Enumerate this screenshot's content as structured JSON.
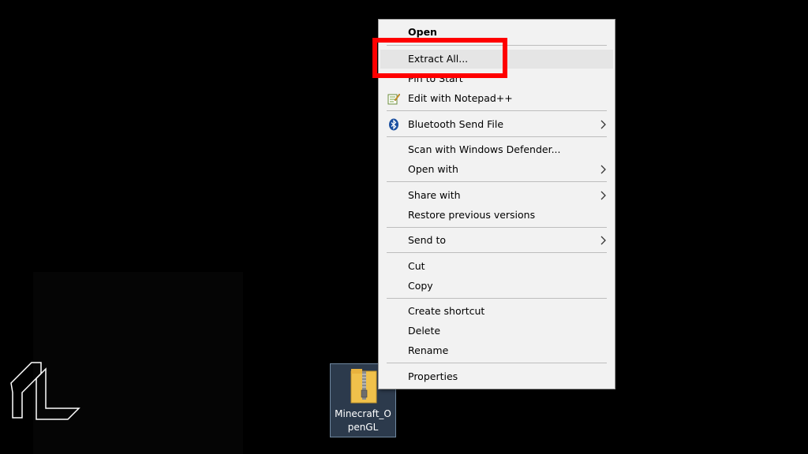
{
  "desktop": {
    "file_name": "Minecraft_OpenGL",
    "file_icon": "zip-folder-icon",
    "logo_icon": "1l-logo-icon"
  },
  "context_menu": {
    "items": [
      {
        "label": "Open",
        "icon": null,
        "submenu": false,
        "bold": true
      },
      {
        "label": "Extract All...",
        "icon": null,
        "submenu": false,
        "highlighted": true
      },
      {
        "label": "Pin to Start",
        "icon": null,
        "submenu": false
      },
      {
        "label": "Edit with Notepad++",
        "icon": "notepad-plus-plus-icon",
        "submenu": false
      },
      {
        "label": "Bluetooth Send File",
        "icon": "bluetooth-icon",
        "submenu": true
      },
      {
        "label": "Scan with Windows Defender...",
        "icon": null,
        "submenu": false
      },
      {
        "label": "Open with",
        "icon": null,
        "submenu": true
      },
      {
        "label": "Share with",
        "icon": null,
        "submenu": true
      },
      {
        "label": "Restore previous versions",
        "icon": null,
        "submenu": false
      },
      {
        "label": "Send to",
        "icon": null,
        "submenu": true
      },
      {
        "label": "Cut",
        "icon": null,
        "submenu": false
      },
      {
        "label": "Copy",
        "icon": null,
        "submenu": false
      },
      {
        "label": "Create shortcut",
        "icon": null,
        "submenu": false
      },
      {
        "label": "Delete",
        "icon": null,
        "submenu": false
      },
      {
        "label": "Rename",
        "icon": null,
        "submenu": false
      },
      {
        "label": "Properties",
        "icon": null,
        "submenu": false
      }
    ]
  },
  "annotation": {
    "highlight_color": "#ff0000"
  }
}
